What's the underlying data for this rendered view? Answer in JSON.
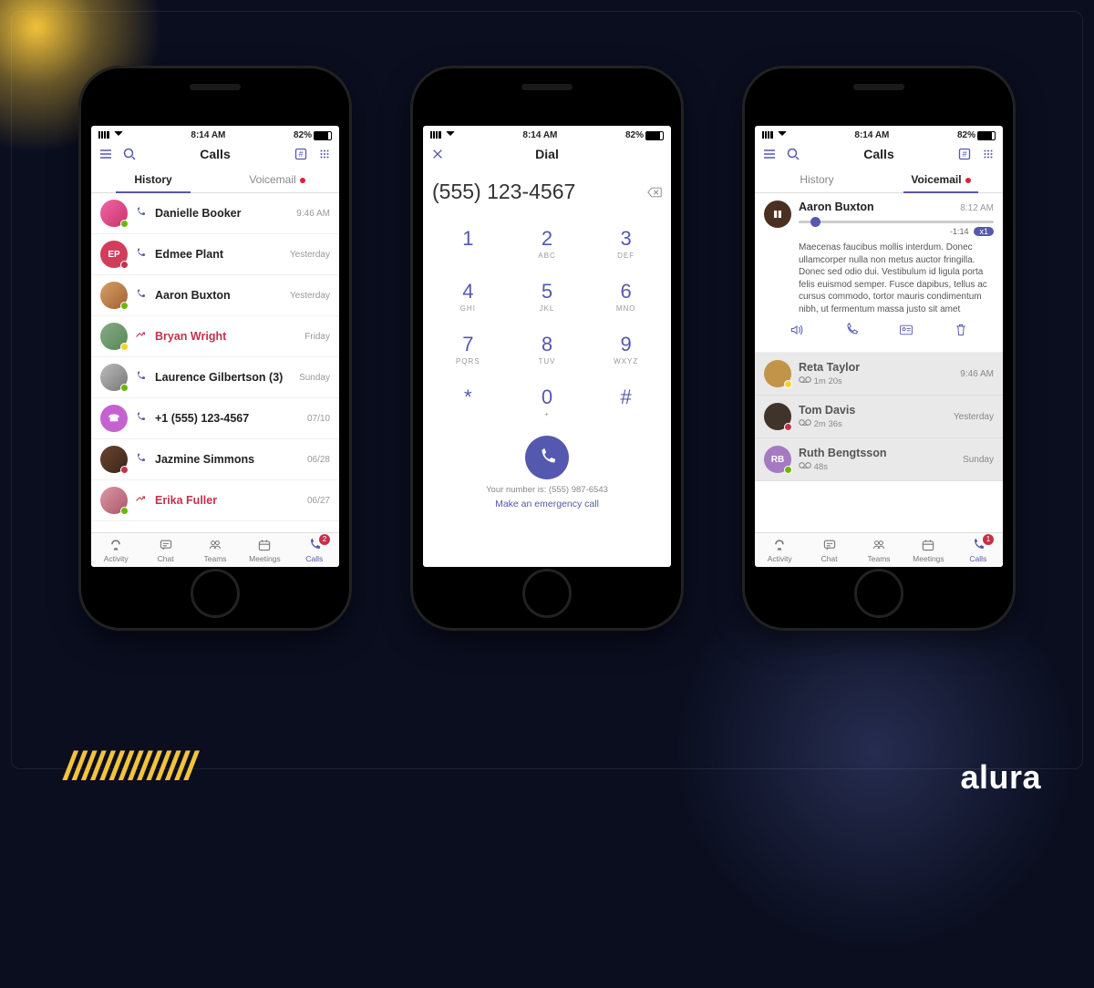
{
  "brand": "alura",
  "status": {
    "time": "8:14 AM",
    "battery": "82%"
  },
  "screen1": {
    "title": "Calls",
    "tabs": {
      "history": "History",
      "voicemail": "Voicemail"
    },
    "rows": [
      {
        "name": "Danielle Booker",
        "time": "9:46 AM",
        "missed": false,
        "avatar": "av1",
        "presence": "pr-green"
      },
      {
        "name": "Edmee Plant",
        "time": "Yesterday",
        "missed": false,
        "avatar": "av2",
        "avatarText": "EP",
        "presence": "pr-red"
      },
      {
        "name": "Aaron Buxton",
        "time": "Yesterday",
        "missed": false,
        "avatar": "av3",
        "presence": "pr-green"
      },
      {
        "name": "Bryan Wright",
        "time": "Friday",
        "missed": true,
        "avatar": "av4",
        "presence": "pr-yellow"
      },
      {
        "name": "Laurence Gilbertson (3)",
        "time": "Sunday",
        "missed": false,
        "avatar": "av5",
        "presence": "pr-green"
      },
      {
        "name": "+1 (555) 123-4567",
        "time": "07/10",
        "missed": false,
        "avatar": "av6",
        "avatarText": "☎",
        "presence": ""
      },
      {
        "name": "Jazmine Simmons",
        "time": "06/28",
        "missed": false,
        "avatar": "av7",
        "presence": "pr-red"
      },
      {
        "name": "Erika Fuller",
        "time": "06/27",
        "missed": true,
        "avatar": "av8",
        "presence": "pr-green"
      }
    ]
  },
  "screen2": {
    "title": "Dial",
    "number": "(555) 123-4567",
    "keys": [
      {
        "d": "1",
        "l": ""
      },
      {
        "d": "2",
        "l": "ABC"
      },
      {
        "d": "3",
        "l": "DEF"
      },
      {
        "d": "4",
        "l": "GHI"
      },
      {
        "d": "5",
        "l": "JKL"
      },
      {
        "d": "6",
        "l": "MNO"
      },
      {
        "d": "7",
        "l": "PQRS"
      },
      {
        "d": "8",
        "l": "TUV"
      },
      {
        "d": "9",
        "l": "WXYZ"
      },
      {
        "d": "*",
        "l": ""
      },
      {
        "d": "0",
        "l": "+"
      },
      {
        "d": "#",
        "l": ""
      }
    ],
    "yourNumber": "Your number is: (555) 987-6543",
    "emergency": "Make an emergency call"
  },
  "screen3": {
    "title": "Calls",
    "tabs": {
      "history": "History",
      "voicemail": "Voicemail"
    },
    "detail": {
      "name": "Aaron Buxton",
      "time": "8:12 AM",
      "remaining": "-1:14",
      "speed": "x1",
      "transcript": "Maecenas faucibus mollis interdum. Donec ullamcorper nulla non metus auctor fringilla. Donec sed odio dui. Vestibulum id ligula porta felis euismod semper. Fusce dapibus, tellus ac cursus commodo, tortor mauris condimentum nibh, ut fermentum massa justo sit amet"
    },
    "rows": [
      {
        "name": "Reta Taylor",
        "dur": "1m 20s",
        "time": "9:46 AM",
        "avatar": "av10",
        "presence": "pr-yellow"
      },
      {
        "name": "Tom Davis",
        "dur": "2m 36s",
        "time": "Yesterday",
        "avatar": "av11",
        "presence": "pr-red"
      },
      {
        "name": "Ruth Bengtsson",
        "dur": "48s",
        "time": "Sunday",
        "avatar": "av12",
        "avatarText": "RB",
        "presence": "pr-green"
      }
    ]
  },
  "bottomNav": {
    "items": [
      {
        "label": "Activity"
      },
      {
        "label": "Chat"
      },
      {
        "label": "Teams"
      },
      {
        "label": "Meetings"
      },
      {
        "label": "Calls",
        "active": true,
        "badge": "2"
      }
    ]
  },
  "bottomNav3Badge": "1"
}
